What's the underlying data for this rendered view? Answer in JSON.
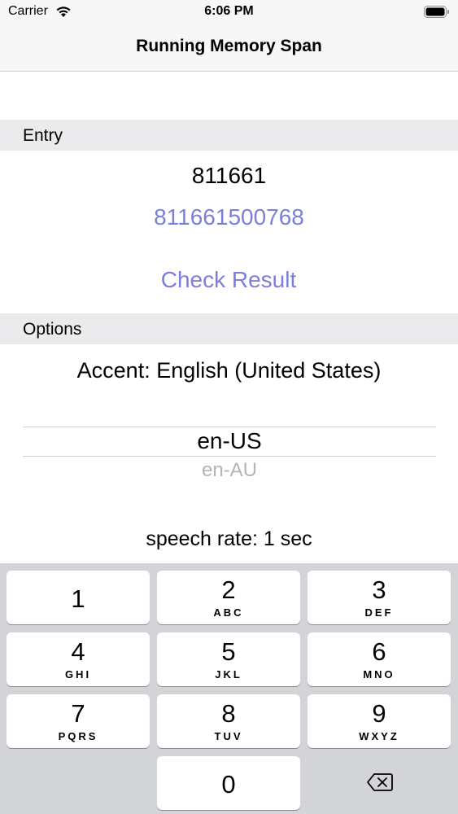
{
  "status": {
    "carrier": "Carrier",
    "time": "6:06 PM"
  },
  "nav": {
    "title": "Running Memory Span"
  },
  "entry": {
    "header": "Entry",
    "value": "811661",
    "answer": "811661500768",
    "check_label": "Check Result"
  },
  "options": {
    "header": "Options",
    "accent_label": "Accent: English (United States)",
    "picker": {
      "selected": "en-US",
      "next": "en-AU"
    },
    "speech_rate": "speech rate: 1 sec"
  },
  "keypad": {
    "keys": [
      {
        "digit": "1",
        "letters": ""
      },
      {
        "digit": "2",
        "letters": "ABC"
      },
      {
        "digit": "3",
        "letters": "DEF"
      },
      {
        "digit": "4",
        "letters": "GHI"
      },
      {
        "digit": "5",
        "letters": "JKL"
      },
      {
        "digit": "6",
        "letters": "MNO"
      },
      {
        "digit": "7",
        "letters": "PQRS"
      },
      {
        "digit": "8",
        "letters": "TUV"
      },
      {
        "digit": "9",
        "letters": "WXYZ"
      },
      {
        "digit": "0",
        "letters": ""
      }
    ]
  },
  "colors": {
    "accent": "#7b7fd9",
    "section_bg": "#ebebed",
    "keypad_bg": "#d3d4d8"
  }
}
